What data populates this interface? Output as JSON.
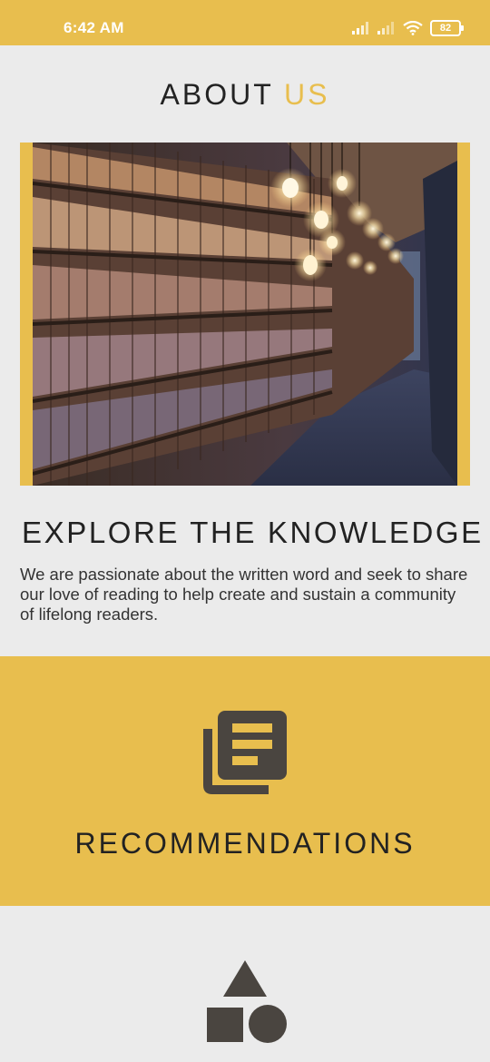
{
  "status_bar": {
    "time": "6:42 AM",
    "battery": "82"
  },
  "about": {
    "title_main": "ABOUT",
    "title_accent": "US"
  },
  "explore": {
    "headline": "EXPLORE THE KNOWLEDGE",
    "body": "We are passionate about the written word and seek to share our love of reading to help create and sustain a community of lifelong readers."
  },
  "recommendations": {
    "label": "RECOMMENDATIONS",
    "icon": "library-books-icon"
  },
  "next_section": {
    "icon": "shapes-icon"
  },
  "colors": {
    "accent": "#e8be4e",
    "background": "#ebebeb",
    "icon_dark": "#4a4540"
  }
}
